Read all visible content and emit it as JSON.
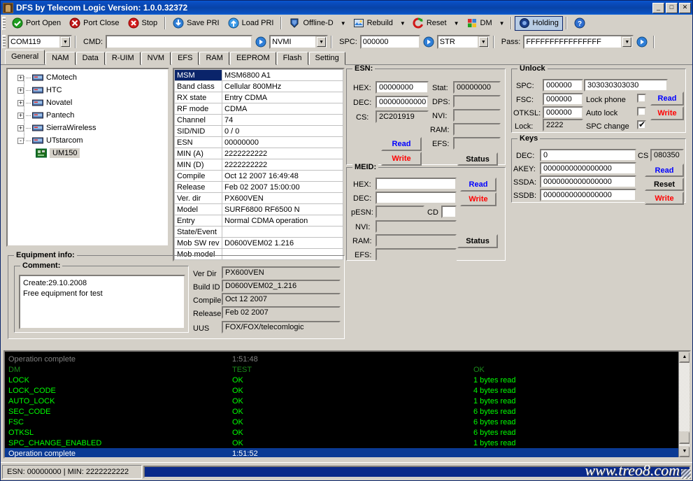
{
  "window": {
    "title": "DFS by Telecom Logic  Version: 1.0.0.32372",
    "minimize": "_",
    "maximize": "□",
    "close": "✕"
  },
  "toolbar": {
    "items": [
      {
        "label": "Port Open",
        "icon": "port-open-icon",
        "arrow": false,
        "pressed": false
      },
      {
        "label": "Port Close",
        "icon": "port-close-icon",
        "arrow": false,
        "pressed": false
      },
      {
        "label": "Stop",
        "icon": "stop-icon",
        "arrow": false,
        "pressed": false
      },
      {
        "label": "Save PRI",
        "icon": "save-pri-icon",
        "arrow": false,
        "pressed": false
      },
      {
        "label": "Load PRI",
        "icon": "load-pri-icon",
        "arrow": false,
        "pressed": false
      },
      {
        "label": "Offline-D",
        "icon": "offline-icon",
        "arrow": true,
        "pressed": false
      },
      {
        "label": "Rebuild",
        "icon": "rebuild-icon",
        "arrow": true,
        "pressed": false
      },
      {
        "label": "Reset",
        "icon": "reset-icon",
        "arrow": true,
        "pressed": false
      },
      {
        "label": "DM",
        "icon": "dm-icon",
        "arrow": true,
        "pressed": false
      },
      {
        "label": "Holding",
        "icon": "holding-icon",
        "arrow": false,
        "pressed": true
      }
    ],
    "help_icon": "help-icon"
  },
  "toolbar2": {
    "port": "COM119",
    "cmd_label": "CMD:",
    "cmd_value": "",
    "cmd_placeholder": "",
    "nv_mode": "NVMI",
    "spc_label": "SPC:",
    "spc_value": "000000",
    "str_mode": "STR",
    "pass_label": "Pass:",
    "pass_value": "FFFFFFFFFFFFFFFF",
    "go_icon": "go-icon"
  },
  "tabs": [
    {
      "label": "General",
      "active": true
    },
    {
      "label": "NAM",
      "active": false
    },
    {
      "label": "Data",
      "active": false
    },
    {
      "label": "R-UIM",
      "active": false
    },
    {
      "label": "NVM",
      "active": false
    },
    {
      "label": "EFS",
      "active": false
    },
    {
      "label": "RAM",
      "active": false
    },
    {
      "label": "EEPROM",
      "active": false
    },
    {
      "label": "Flash",
      "active": false
    },
    {
      "label": "Setting",
      "active": false
    }
  ],
  "tree": {
    "nodes": [
      {
        "label": "CMotech",
        "expander": "+",
        "child": false
      },
      {
        "label": "HTC",
        "expander": "+",
        "child": false
      },
      {
        "label": "Novatel",
        "expander": "+",
        "child": false
      },
      {
        "label": "Pantech",
        "expander": "+",
        "child": false
      },
      {
        "label": "SierraWireless",
        "expander": "+",
        "child": false
      },
      {
        "label": "UTstarcom",
        "expander": "-",
        "child": false
      },
      {
        "label": "UM150",
        "expander": "",
        "child": true
      }
    ]
  },
  "msm_table": {
    "rows": [
      {
        "key": "MSM",
        "value": "MSM6800  A1",
        "selected": true
      },
      {
        "key": "Band class",
        "value": "Cellular  800MHz",
        "selected": false
      },
      {
        "key": "RX state",
        "value": "Entry  CDMA",
        "selected": false
      },
      {
        "key": "RF mode",
        "value": "CDMA",
        "selected": false
      },
      {
        "key": "Channel",
        "value": "74",
        "selected": false
      },
      {
        "key": "SID/NID",
        "value": "0 / 0",
        "selected": false
      },
      {
        "key": "ESN",
        "value": "00000000",
        "selected": false
      },
      {
        "key": "MIN (A)",
        "value": "2222222222",
        "selected": false
      },
      {
        "key": "MIN (D)",
        "value": "2222222222",
        "selected": false
      },
      {
        "key": "Compile",
        "value": "Oct 12 2007 16:49:48",
        "selected": false
      },
      {
        "key": "Release",
        "value": "Feb 02 2007 15:00:00",
        "selected": false
      },
      {
        "key": "Ver. dir",
        "value": "PX600VEN",
        "selected": false
      },
      {
        "key": "Model",
        "value": "SURF6800  RF6500  N",
        "selected": false
      },
      {
        "key": "Entry",
        "value": "Normal  CDMA  operation",
        "selected": false
      },
      {
        "key": "State/Event",
        "value": "",
        "selected": false
      },
      {
        "key": "Mob SW rev",
        "value": "D0600VEM02 1.216",
        "selected": false
      },
      {
        "key": "Mob model",
        "value": "",
        "selected": false
      }
    ]
  },
  "esn": {
    "title": "ESN:",
    "hex_label": "HEX:",
    "hex_value": "00000000",
    "dec_label": "DEC:",
    "dec_value": "00000000000",
    "cs_label": "CS:",
    "cs_value": "2C201919",
    "stat_label": "Stat:",
    "stat_value": "00000000",
    "dps_label": "DPS:",
    "dps_value": "",
    "nvi_label": "NVI:",
    "nvi_value": "",
    "ram_label": "RAM:",
    "ram_value": "",
    "efs_label": "EFS:",
    "efs_value": "",
    "read_label": "Read",
    "write_label": "Write",
    "status_label": "Status"
  },
  "meid": {
    "title": "MEID:",
    "hex_label": "HEX:",
    "hex_value": "",
    "dec_label": "DEC:",
    "dec_value": "",
    "pesn_label": "pESN:",
    "pesn_value": "",
    "cd_label": "CD",
    "cd_value": "",
    "nvi_label": "NVI:",
    "nvi_value": "",
    "ram_label": "RAM:",
    "ram_value": "",
    "efs_label": "EFS:",
    "efs_value": "",
    "read_label": "Read",
    "write_label": "Write",
    "status_label": "Status"
  },
  "unlock": {
    "title": "Unlock",
    "spc_label": "SPC:",
    "spc_value": "000000",
    "spc_hex": "303030303030",
    "fsc_label": "FSC:",
    "fsc_value": "000000",
    "otksl_label": "OTKSL:",
    "otksl_value": "000000",
    "lock_label": "Lock:",
    "lock_value": "2222",
    "lock_phone_label": "Lock phone",
    "lock_phone_checked": false,
    "auto_lock_label": "Auto lock",
    "auto_lock_checked": false,
    "spc_change_label": "SPC change",
    "spc_change_checked": true,
    "read_label": "Read",
    "write_label": "Write"
  },
  "keys": {
    "title": "Keys",
    "dec_label": "DEC:",
    "dec_value": "0",
    "cs_label": "CS",
    "cs_value": "080350",
    "akey_label": "AKEY:",
    "akey_value": "0000000000000000",
    "ssda_label": "SSDA:",
    "ssda_value": "0000000000000000",
    "ssdb_label": "SSDB:",
    "ssdb_value": "0000000000000000",
    "read_label": "Read",
    "reset_label": "Reset",
    "write_label": "Write"
  },
  "equipment": {
    "title": "Equipment info:",
    "comment_title": "Comment:",
    "comment_lines": [
      "Create:29.10.2008",
      "Free equipment for test"
    ],
    "fields": [
      {
        "label": "Ver Dir",
        "value": "PX600VEN"
      },
      {
        "label": "Build ID",
        "value": "D0600VEM02_1.216"
      },
      {
        "label": "Compile",
        "value": "Oct 12 2007"
      },
      {
        "label": "Release",
        "value": "Feb 02 2007"
      },
      {
        "label": "UUS",
        "value": "FOX/FOX/telecomlogic"
      }
    ]
  },
  "console": {
    "rows": [
      {
        "c1": "Operation complete",
        "c2": "1:51:48",
        "c3": "",
        "color": "#808080",
        "selected": false
      },
      {
        "c1": "DM",
        "c2": "TEST",
        "c3": "OK",
        "color": "#1a8a1a",
        "selected": false
      },
      {
        "c1": "LOCK",
        "c2": "OK",
        "c3": "1 bytes read",
        "color": "#00ff00",
        "selected": false
      },
      {
        "c1": "LOCK_CODE",
        "c2": "OK",
        "c3": "4 bytes read",
        "color": "#00ff00",
        "selected": false
      },
      {
        "c1": "AUTO_LOCK",
        "c2": "OK",
        "c3": "1 bytes read",
        "color": "#00ff00",
        "selected": false
      },
      {
        "c1": "SEC_CODE",
        "c2": "OK",
        "c3": "6 bytes read",
        "color": "#00ff00",
        "selected": false
      },
      {
        "c1": "FSC",
        "c2": "OK",
        "c3": "6 bytes read",
        "color": "#00ff00",
        "selected": false
      },
      {
        "c1": "OTKSL",
        "c2": "OK",
        "c3": "6 bytes read",
        "color": "#00ff00",
        "selected": false
      },
      {
        "c1": "SPC_CHANGE_ENABLED",
        "c2": "OK",
        "c3": "1 bytes read",
        "color": "#00ff00",
        "selected": false
      },
      {
        "c1": "Operation complete",
        "c2": "1:51:52",
        "c3": "",
        "color": "#ffffff",
        "selected": true
      }
    ],
    "scroll_up_icon": "scroll-up-arrow-icon",
    "scroll_down_icon": "scroll-down-arrow-icon"
  },
  "statusbar": {
    "esn_text": "ESN:  00000000  |  MIN:  2222222222",
    "progress_percent": 100,
    "watermark": "www.treo8.com"
  },
  "colors": {
    "titlebar": "#0843a8",
    "face": "#d4d0c8",
    "read_blue": "#0000ff",
    "write_red": "#ff0000",
    "console_green": "#00ff00",
    "selection": "#0a3a94"
  }
}
